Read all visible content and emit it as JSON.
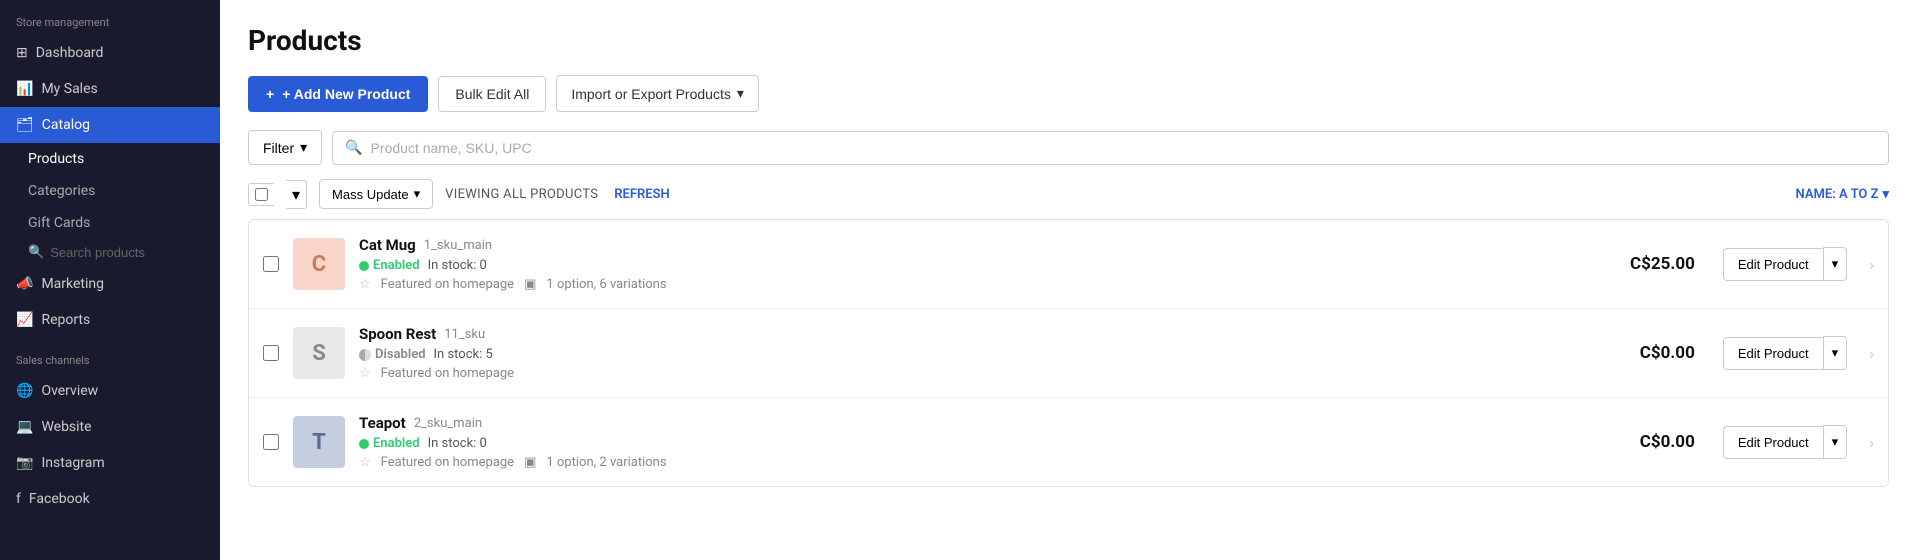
{
  "sidebar": {
    "store_management_label": "Store management",
    "items": [
      {
        "id": "dashboard",
        "label": "Dashboard",
        "active": false
      },
      {
        "id": "my-sales",
        "label": "My Sales",
        "active": false
      },
      {
        "id": "catalog",
        "label": "Catalog",
        "active": true
      }
    ],
    "catalog_subitems": [
      {
        "id": "products",
        "label": "Products",
        "active": true
      },
      {
        "id": "categories",
        "label": "Categories",
        "active": false
      },
      {
        "id": "gift-cards",
        "label": "Gift Cards",
        "active": false
      }
    ],
    "search_placeholder": "Search products",
    "other_items": [
      {
        "id": "marketing",
        "label": "Marketing"
      },
      {
        "id": "reports",
        "label": "Reports"
      }
    ],
    "sales_channels_label": "Sales channels",
    "sales_channels": [
      {
        "id": "overview",
        "label": "Overview"
      },
      {
        "id": "website",
        "label": "Website"
      },
      {
        "id": "instagram",
        "label": "Instagram"
      },
      {
        "id": "facebook",
        "label": "Facebook"
      }
    ]
  },
  "page": {
    "title": "Products",
    "add_button": "+ Add New Product",
    "bulk_edit_button": "Bulk Edit All",
    "import_export_button": "Import or Export Products",
    "filter_button": "Filter",
    "search_placeholder": "Product name, SKU, UPC",
    "mass_update_button": "Mass Update",
    "viewing_text": "VIEWING ALL PRODUCTS",
    "refresh_text": "REFRESH",
    "sort_label": "NAME: A TO Z",
    "products": [
      {
        "id": "cat-mug",
        "initial": "C",
        "avatar_color": "#f9d5c9",
        "initial_color": "#c97a5a",
        "name": "Cat Mug",
        "sku": "1_sku_main",
        "status": "Enabled",
        "stock": "In stock: 0",
        "featured": "Featured on homepage",
        "variations": "1 option, 6 variations",
        "price": "C$25.00",
        "edit_label": "Edit Product"
      },
      {
        "id": "spoon-rest",
        "initial": "S",
        "avatar_color": "#e8e8e8",
        "initial_color": "#888",
        "name": "Spoon Rest",
        "sku": "11_sku",
        "status": "Disabled",
        "stock": "In stock: 5",
        "featured": "Featured on homepage",
        "variations": "",
        "price": "C$0.00",
        "edit_label": "Edit Product"
      },
      {
        "id": "teapot",
        "initial": "T",
        "avatar_color": "#c5cee0",
        "initial_color": "#5a6a99",
        "name": "Teapot",
        "sku": "2_sku_main",
        "status": "Enabled",
        "stock": "In stock: 0",
        "featured": "Featured on homepage",
        "variations": "1 option, 2 variations",
        "price": "C$0.00",
        "edit_label": "Edit Product"
      }
    ]
  }
}
